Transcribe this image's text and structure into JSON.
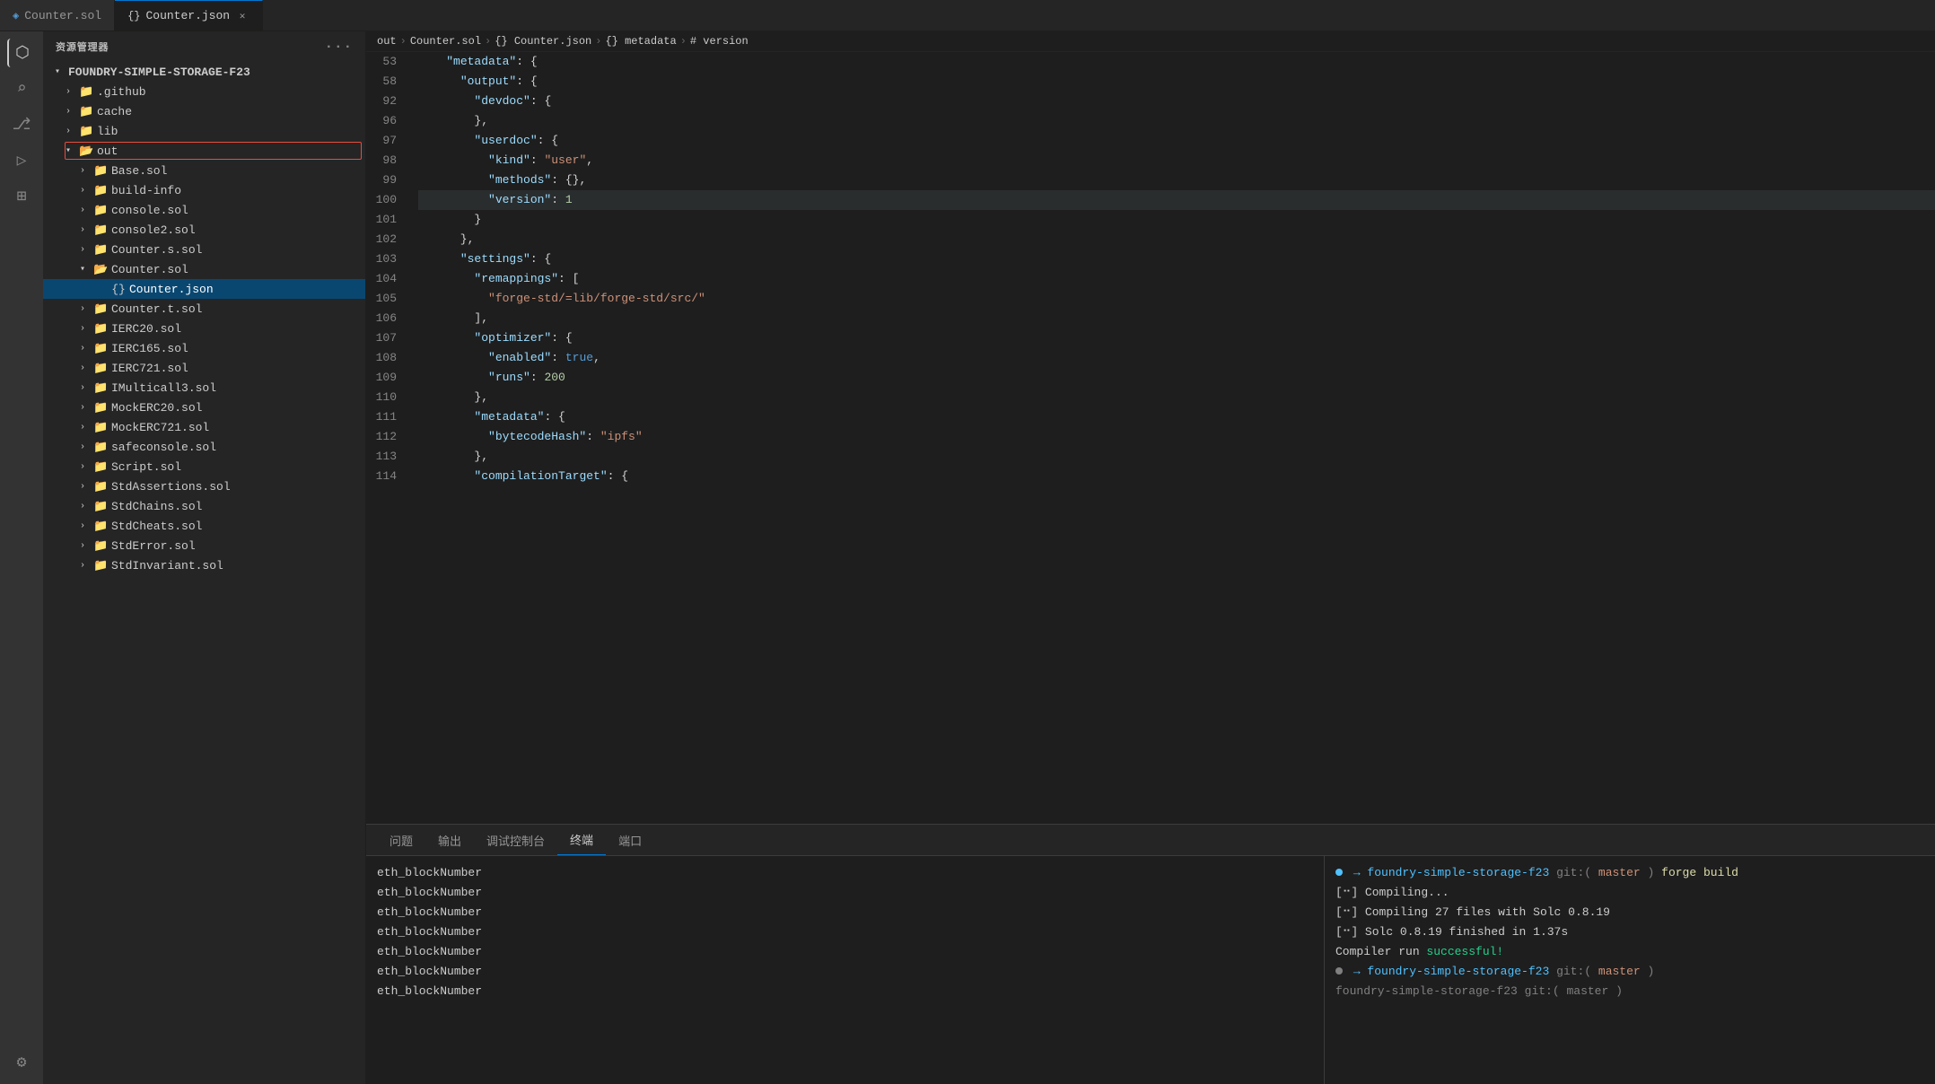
{
  "tabs": [
    {
      "id": "counter-sol",
      "label": "Counter.sol",
      "icon": "sol",
      "active": false,
      "closeable": false
    },
    {
      "id": "counter-json",
      "label": "Counter.json",
      "icon": "json",
      "active": true,
      "closeable": true
    }
  ],
  "sidebar": {
    "title": "资源管理器",
    "root_folder": "FOUNDRY-SIMPLE-STORAGE-F23",
    "items": [
      {
        "id": "github",
        "type": "folder",
        "label": ".github",
        "level": 1,
        "collapsed": true
      },
      {
        "id": "cache",
        "type": "folder",
        "label": "cache",
        "level": 1,
        "collapsed": true
      },
      {
        "id": "lib",
        "type": "folder",
        "label": "lib",
        "level": 1,
        "collapsed": true
      },
      {
        "id": "out",
        "type": "folder",
        "label": "out",
        "level": 1,
        "collapsed": false,
        "selected": true,
        "border": true
      },
      {
        "id": "base-sol",
        "type": "folder",
        "label": "Base.sol",
        "level": 2,
        "collapsed": true
      },
      {
        "id": "build-info",
        "type": "folder",
        "label": "build-info",
        "level": 2,
        "collapsed": true
      },
      {
        "id": "console-sol",
        "type": "folder",
        "label": "console.sol",
        "level": 2,
        "collapsed": true
      },
      {
        "id": "console2-sol",
        "type": "folder",
        "label": "console2.sol",
        "level": 2,
        "collapsed": true
      },
      {
        "id": "counter-s-sol",
        "type": "folder",
        "label": "Counter.s.sol",
        "level": 2,
        "collapsed": true
      },
      {
        "id": "counter-sol-folder",
        "type": "folder",
        "label": "Counter.sol",
        "level": 2,
        "collapsed": false
      },
      {
        "id": "counter-json-file",
        "type": "file",
        "label": "Counter.json",
        "level": 3,
        "active": true
      },
      {
        "id": "counter-t-sol",
        "type": "folder",
        "label": "Counter.t.sol",
        "level": 2,
        "collapsed": true
      },
      {
        "id": "ierc20-sol",
        "type": "folder",
        "label": "IERC20.sol",
        "level": 2,
        "collapsed": true
      },
      {
        "id": "ierc165-sol",
        "type": "folder",
        "label": "IERC165.sol",
        "level": 2,
        "collapsed": true
      },
      {
        "id": "ierc721-sol",
        "type": "folder",
        "label": "IERC721.sol",
        "level": 2,
        "collapsed": true
      },
      {
        "id": "imulticall3-sol",
        "type": "folder",
        "label": "IMulticall3.sol",
        "level": 2,
        "collapsed": true
      },
      {
        "id": "mockerc20-sol",
        "type": "folder",
        "label": "MockERC20.sol",
        "level": 2,
        "collapsed": true
      },
      {
        "id": "mockerc721-sol",
        "type": "folder",
        "label": "MockERC721.sol",
        "level": 2,
        "collapsed": true
      },
      {
        "id": "safeconsole-sol",
        "type": "folder",
        "label": "safeconsole.sol",
        "level": 2,
        "collapsed": true
      },
      {
        "id": "script-sol",
        "type": "folder",
        "label": "Script.sol",
        "level": 2,
        "collapsed": true
      },
      {
        "id": "stdassertions-sol",
        "type": "folder",
        "label": "StdAssertions.sol",
        "level": 2,
        "collapsed": true
      },
      {
        "id": "stdchains-sol",
        "type": "folder",
        "label": "StdChains.sol",
        "level": 2,
        "collapsed": true
      },
      {
        "id": "stdcheats-sol",
        "type": "folder",
        "label": "StdCheats.sol",
        "level": 2,
        "collapsed": true
      },
      {
        "id": "stderr-sol",
        "type": "folder",
        "label": "StdError.sol",
        "level": 2,
        "collapsed": true
      },
      {
        "id": "stdinvariant-sol",
        "type": "folder",
        "label": "StdInvariant.sol",
        "level": 2,
        "collapsed": true
      }
    ]
  },
  "breadcrumb": {
    "items": [
      "out",
      "Counter.sol",
      "{} Counter.json",
      "{} metadata",
      "# version"
    ]
  },
  "code": {
    "lines": [
      {
        "num": 53,
        "content": "    \"metadata\": {"
      },
      {
        "num": 58,
        "content": "      \"output\": {"
      },
      {
        "num": 92,
        "content": "        \"devdoc\": {"
      },
      {
        "num": 96,
        "content": "        },"
      },
      {
        "num": 97,
        "content": "        \"userdoc\": {"
      },
      {
        "num": 98,
        "content": "          \"kind\": \"user\","
      },
      {
        "num": 99,
        "content": "          \"methods\": {},"
      },
      {
        "num": 100,
        "content": "          \"version\": 1"
      },
      {
        "num": 101,
        "content": "        }"
      },
      {
        "num": 102,
        "content": "      },"
      },
      {
        "num": 103,
        "content": "      \"settings\": {"
      },
      {
        "num": 104,
        "content": "        \"remappings\": ["
      },
      {
        "num": 105,
        "content": "          \"forge-std/=lib/forge-std/src/\""
      },
      {
        "num": 106,
        "content": "        ],"
      },
      {
        "num": 107,
        "content": "        \"optimizer\": {"
      },
      {
        "num": 108,
        "content": "          \"enabled\": true,"
      },
      {
        "num": 109,
        "content": "          \"runs\": 200"
      },
      {
        "num": 110,
        "content": "        },"
      },
      {
        "num": 111,
        "content": "        \"metadata\": {"
      },
      {
        "num": 112,
        "content": "          \"bytecodeHash\": \"ipfs\""
      },
      {
        "num": 113,
        "content": "        },"
      },
      {
        "num": 114,
        "content": "        \"compilationTarget\": {"
      }
    ]
  },
  "terminal": {
    "tabs": [
      "问题",
      "输出",
      "调试控制台",
      "终端",
      "端口"
    ],
    "active_tab": "终端",
    "left_lines": [
      "eth_blockNumber",
      "eth_blockNumber",
      "eth_blockNumber",
      "eth_blockNumber",
      "eth_blockNumber",
      "eth_blockNumber",
      "eth_blockNumber"
    ],
    "right_lines": [
      {
        "type": "command",
        "text": "foundry-simple-storage-f23 git:(master) forge build"
      },
      {
        "type": "info",
        "text": "[⠒] Compiling..."
      },
      {
        "type": "info",
        "text": "[⠒] Compiling 27 files with Solc 0.8.19"
      },
      {
        "type": "info",
        "text": "[⠒] Solc 0.8.19 finished in 1.37s"
      },
      {
        "type": "success",
        "text": "Compiler run successful!"
      },
      {
        "type": "prompt",
        "text": "foundry-simple-storage-f23 git:(master)"
      },
      {
        "type": "prompt2",
        "text": "foundry-simple-storage-f23 git:(master)"
      }
    ]
  }
}
